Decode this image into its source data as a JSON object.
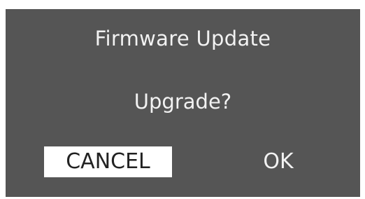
{
  "dialog": {
    "title": "Firmware Update",
    "prompt": "Upgrade?",
    "cancel_label": "CANCEL",
    "ok_label": "OK",
    "selected_button": "CANCEL"
  },
  "colors": {
    "screen_background": "#555555",
    "text": "#f2f2f2",
    "selected_background": "#ffffff",
    "selected_text": "#222222"
  }
}
